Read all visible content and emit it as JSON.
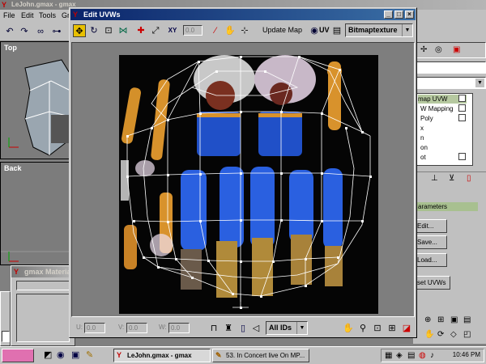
{
  "app": {
    "title": "LeJohn.gmax - gmax",
    "menu": [
      "File",
      "Edit",
      "Tools",
      "Gr"
    ]
  },
  "viewports": {
    "top_label": "Top",
    "back_label": "Back"
  },
  "command_panel": {
    "modifier_list": [
      {
        "label": "map UVW",
        "selected": true
      },
      {
        "label": "W Mapping",
        "selected": false
      },
      {
        "label": "Poly",
        "selected": false
      },
      {
        "label": "x",
        "selected": false
      },
      {
        "label": "n",
        "selected": false
      },
      {
        "label": "on",
        "selected": false
      },
      {
        "label": "ot",
        "selected": false
      }
    ],
    "rollout_title": "arameters",
    "edit_button": "Edit...",
    "save_button": "Save...",
    "load_button": "Load...",
    "reset_button": "set UVWs"
  },
  "uvw_dialog": {
    "title": "Edit UVWs",
    "update_map_label": "Update Map",
    "uvw_toggle": "UV",
    "texture_dropdown": "Bitmaptexture",
    "top_spinner": "0.0",
    "u_label": "U:",
    "u_value": "0.0",
    "v_label": "V:",
    "v_value": "0.0",
    "w_label": "W:",
    "w_value": "0.0",
    "id_dropdown": "All IDs"
  },
  "material_editor": {
    "title": "gmax Materia"
  },
  "taskbar": {
    "tasks": [
      {
        "label": "LeJohn.gmax - gmax",
        "active": true
      },
      {
        "label": "53. In Concert live On MP...",
        "active": false
      }
    ],
    "clock": "10:46 PM"
  }
}
